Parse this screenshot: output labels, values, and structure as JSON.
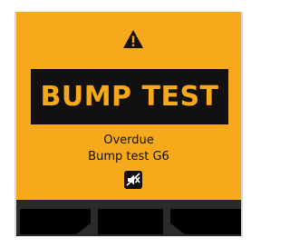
{
  "alert": {
    "banner_text": "BUMP TEST",
    "message_line1": "Overdue",
    "message_line2": "Bump test G6",
    "warning_icon": "warning-triangle-icon",
    "mute_icon": "speaker-muted-icon"
  },
  "softkeys": [
    {
      "label": ""
    },
    {
      "label": ""
    },
    {
      "label": ""
    }
  ],
  "colors": {
    "background": "#f6a91b",
    "banner": "#111111",
    "banner_text": "#f6a91b",
    "footer": "#2a2a2a",
    "softkey": "#000000"
  }
}
